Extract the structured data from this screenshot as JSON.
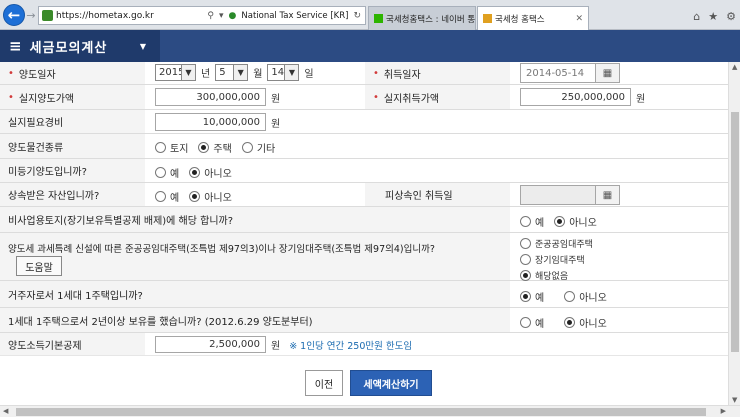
{
  "browser": {
    "url": "https://hometax.go.kr",
    "cert_label": "National Tax Service [KR]",
    "tabs": [
      {
        "label": "국세청홈택스 : 네이버 통합검색"
      },
      {
        "label": "국세청 홈택스"
      }
    ],
    "icons": [
      "home-icon",
      "star-icon",
      "gear-icon"
    ]
  },
  "header": {
    "title": "세금모의계산"
  },
  "form": {
    "transfer_date": {
      "label": "양도일자",
      "year": "2015",
      "year_unit": "년",
      "month": "5",
      "month_unit": "월",
      "day": "14",
      "day_unit": "일"
    },
    "acquisition_date": {
      "label": "취득일자",
      "value": "2014-05-14"
    },
    "actual_transfer_price": {
      "label": "실지양도가액",
      "value": "300,000,000",
      "unit": "원"
    },
    "actual_acquisition_price": {
      "label": "실지취득가액",
      "value": "250,000,000",
      "unit": "원"
    },
    "actual_expenses": {
      "label": "실지필요경비",
      "value": "10,000,000",
      "unit": "원"
    },
    "property_type": {
      "label": "양도물건종류",
      "options": [
        "토지",
        "주택",
        "기타"
      ],
      "selected": "주택"
    },
    "unregistered": {
      "label": "미등기양도입니까?",
      "options": [
        "예",
        "아니오"
      ],
      "selected": "아니오"
    },
    "inherited": {
      "label": "상속받은 자산입니까?",
      "options": [
        "예",
        "아니오"
      ],
      "selected": "아니오"
    },
    "decedent_acq_date": {
      "label": "피상속인 취득일",
      "value": ""
    },
    "non_business_land": {
      "label": "비사업용토지(장기보유특별공제 배제)에 해당 합니까?",
      "options": [
        "예",
        "아니오"
      ],
      "selected": "아니오"
    },
    "special_rental": {
      "label": "양도세 과세특례 신설에 따른 준공공임대주택(조특법 제97의3)이나 장기임대주택(조특법 제97의4)입니까?",
      "help_label": "도움말",
      "options": [
        "준공공임대주택",
        "장기임대주택",
        "해당없음"
      ],
      "selected": "해당없음"
    },
    "one_house": {
      "label": "거주자로서 1세대 1주택입니까?",
      "options": [
        "예",
        "아니오"
      ],
      "selected": "예"
    },
    "two_years": {
      "label": "1세대 1주택으로서 2년이상 보유를 했습니까? (2012.6.29 양도분부터)",
      "options": [
        "예",
        "아니오"
      ],
      "selected": "아니오"
    },
    "basic_deduction": {
      "label": "양도소득기본공제",
      "value": "2,500,000",
      "unit": "원",
      "note": "※ 1인당 연간 250만원 한도임"
    }
  },
  "footer": {
    "prev_label": "이전",
    "calc_label": "세액계산하기"
  },
  "colors": {
    "header_bg": "#2c4b83",
    "header_dark": "#1f3a6b",
    "required": "#d23b3b",
    "note": "#1b6bb0",
    "primary_button": "#2c62b5"
  }
}
